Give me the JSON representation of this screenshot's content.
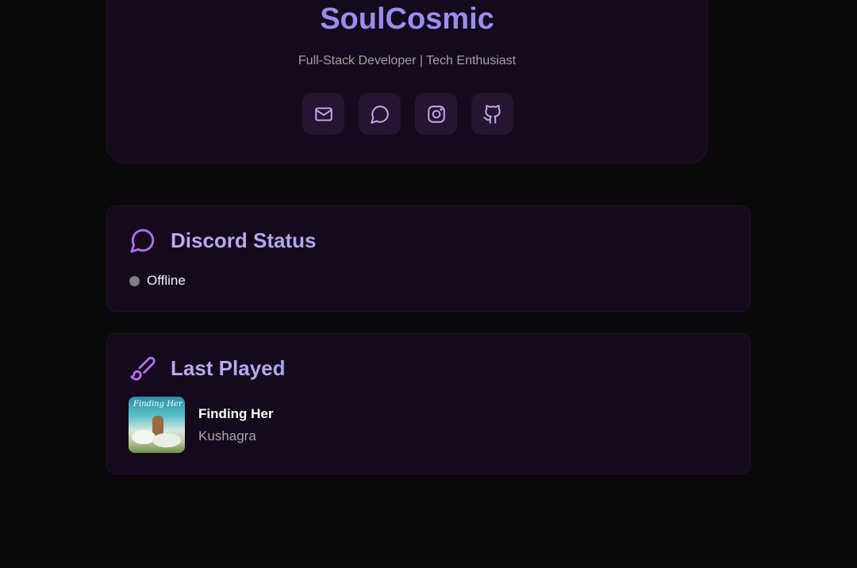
{
  "profile": {
    "name": "SoulCosmic",
    "subtitle": "Full-Stack Developer | Tech Enthusiast",
    "social_links": [
      {
        "icon": "mail-icon",
        "label": "Email"
      },
      {
        "icon": "chat-icon",
        "label": "Discord"
      },
      {
        "icon": "instagram-icon",
        "label": "Instagram"
      },
      {
        "icon": "github-icon",
        "label": "GitHub"
      }
    ]
  },
  "discord": {
    "title": "Discord Status",
    "icon": "chat-bubble-icon",
    "status": "Offline",
    "status_color": "#7d7d83"
  },
  "last_played": {
    "title": "Last Played",
    "icon": "brush-icon",
    "track": {
      "title": "Finding Her",
      "artist": "Kushagra",
      "album_art_text": "Finding Her"
    }
  },
  "colors": {
    "background": "#0a0a0a",
    "card": "#150a1c",
    "accent": "#b46cf0",
    "title_gradient_start": "#a487f0",
    "title_gradient_end": "#8f93f5"
  }
}
